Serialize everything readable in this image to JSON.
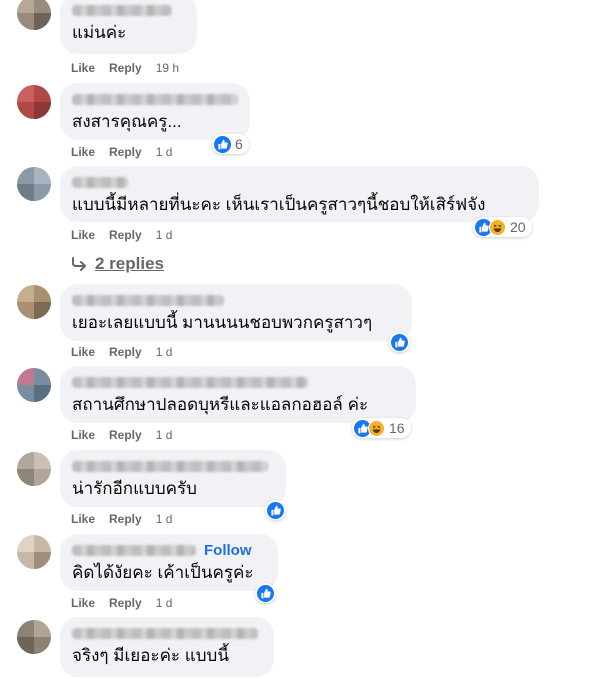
{
  "actions": {
    "like": "Like",
    "reply": "Reply",
    "follow": "Follow"
  },
  "replies_link": {
    "label": "2 replies"
  },
  "colors": {
    "like_blue": "#1877f2",
    "haha_yellow": "#f7b125",
    "bubble_bg": "#f0f2f5",
    "muted": "#65676b"
  },
  "icons": [
    "like-icon",
    "haha-icon",
    "reply-arrow-icon"
  ],
  "comments": [
    {
      "text": "แม่นค่ะ",
      "time": "19 h",
      "reaction_count": ""
    },
    {
      "text": "สงสารคุณครู...",
      "time": "1 d",
      "reaction_count": "6"
    },
    {
      "text": "แบบนี้มีหลายที่นะคะ เห็นเราเป็นครูสาวๆนี้ชอบให้เสิร์ฟจัง",
      "time": "1 d",
      "reaction_count": "20"
    },
    {
      "text": "เยอะเลยแบบนี้ มานนนนชอบพวกครูสาวๆ",
      "time": "1 d",
      "reaction_count": ""
    },
    {
      "text": "สถานศึกษาปลอดบุหรีและแอลกอฮอล์ ค่ะ",
      "time": "1 d",
      "reaction_count": "16"
    },
    {
      "text": "น่ารักอีกแบบครับ",
      "time": "1 d",
      "reaction_count": ""
    },
    {
      "text": "คิดได้งัยคะ เค้าเป็นครูค่ะ",
      "time": "1 d",
      "reaction_count": ""
    },
    {
      "text": "จริงๆ มีเยอะค่ะ แบบนี้",
      "time": "",
      "reaction_count": ""
    }
  ]
}
